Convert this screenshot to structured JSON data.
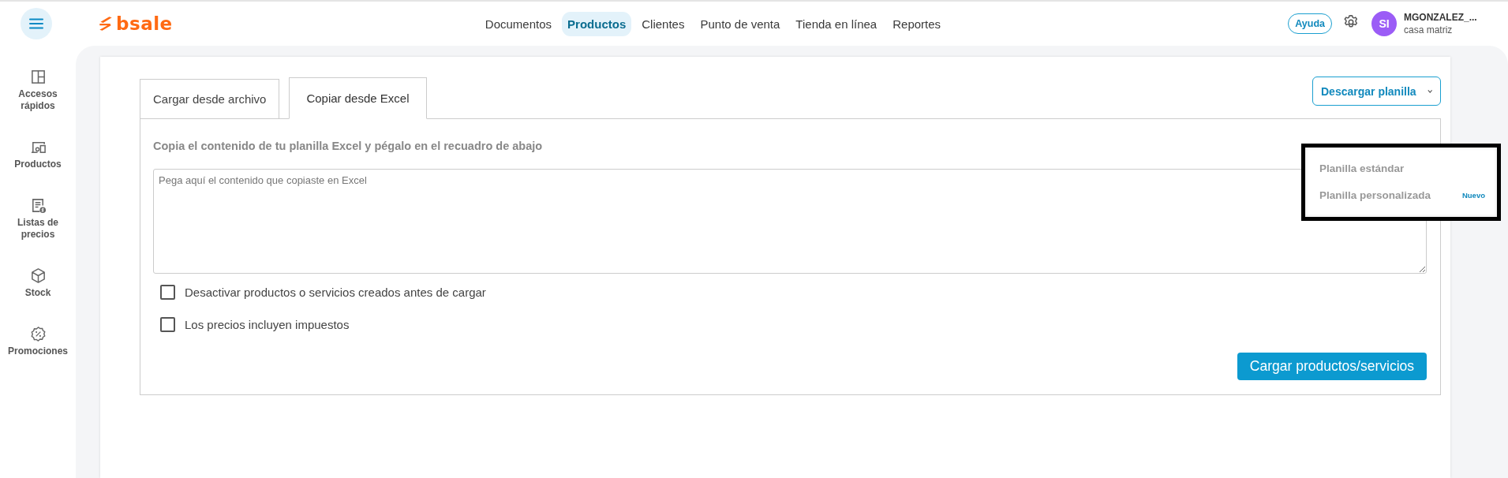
{
  "header": {
    "logo": "bsale",
    "nav": [
      {
        "label": "Documentos",
        "selected": false
      },
      {
        "label": "Productos",
        "selected": true
      },
      {
        "label": "Clientes",
        "selected": false
      },
      {
        "label": "Punto de venta",
        "selected": false
      },
      {
        "label": "Tienda en línea",
        "selected": false
      },
      {
        "label": "Reportes",
        "selected": false
      }
    ],
    "help_button": "Ayuda",
    "user": {
      "initials": "SI",
      "name": "MGONZALEZ_...",
      "branch": "casa matriz"
    }
  },
  "sidebar": {
    "items": [
      {
        "label": "Accesos rápidos"
      },
      {
        "label": "Productos"
      },
      {
        "label": "Listas de precios"
      },
      {
        "label": "Stock"
      },
      {
        "label": "Promociones"
      }
    ]
  },
  "tabs": [
    {
      "label": "Cargar desde archivo",
      "selected": false
    },
    {
      "label": "Copiar desde Excel",
      "selected": true
    }
  ],
  "download_button": {
    "label": "Descargar planilla",
    "expanded": true,
    "menu": [
      {
        "label": "Planilla estándar"
      },
      {
        "label": "Planilla personalizada",
        "badge": "Nuevo"
      }
    ]
  },
  "instructions": "Copia el contenido de tu planilla Excel y pégalo en el recuadro de abajo",
  "paste_field": {
    "placeholder": "Pega aquí el contenido que copiaste en Excel"
  },
  "options": [
    {
      "label": "Desactivar productos o servicios creados antes de cargar",
      "checked": false
    },
    {
      "label": "Los precios incluyen impuestos",
      "checked": false
    }
  ],
  "submit_button": "Cargar productos/servicios"
}
